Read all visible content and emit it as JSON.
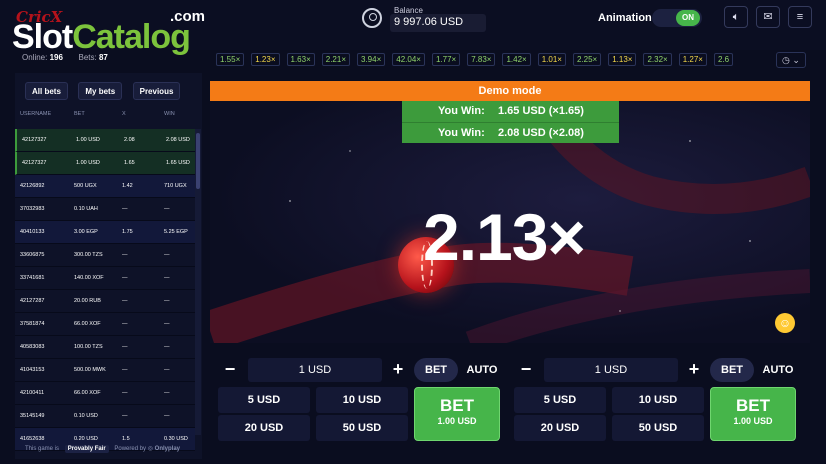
{
  "logo": {
    "crick": "CricX",
    "slot": "Slot",
    "catalog": "Catalog",
    "com": ".com"
  },
  "stats": {
    "online_label": "Online:",
    "online": "196",
    "bets_label": "Bets:",
    "bets": "87"
  },
  "balance": {
    "label": "Balance",
    "value": "9 997.06 USD"
  },
  "animation": {
    "label": "Animation",
    "state": "ON"
  },
  "history": [
    {
      "v": "1.55×",
      "c": "#8fd36b"
    },
    {
      "v": "1.23×",
      "c": "#f4d84a"
    },
    {
      "v": "1.63×",
      "c": "#8fd36b"
    },
    {
      "v": "2.21×",
      "c": "#8fd36b"
    },
    {
      "v": "3.94×",
      "c": "#8fd36b"
    },
    {
      "v": "42.04×",
      "c": "#8fd36b"
    },
    {
      "v": "1.77×",
      "c": "#8fd36b"
    },
    {
      "v": "7.83×",
      "c": "#8fd36b"
    },
    {
      "v": "1.42×",
      "c": "#8fd36b"
    },
    {
      "v": "1.01×",
      "c": "#f4d84a"
    },
    {
      "v": "2.25×",
      "c": "#8fd36b"
    },
    {
      "v": "1.13×",
      "c": "#f4d84a"
    },
    {
      "v": "2.32×",
      "c": "#8fd36b"
    },
    {
      "v": "1.27×",
      "c": "#f4d84a"
    },
    {
      "v": "2.6",
      "c": "#8fd36b"
    }
  ],
  "tabs": [
    "All bets",
    "My bets",
    "Previous"
  ],
  "columns": {
    "user": "USERNAME",
    "bet": "BET",
    "x": "X",
    "win": "WIN"
  },
  "bets": [
    {
      "user": "42127327",
      "bet": "1.00 USD",
      "x": "2.08",
      "win": "2.08 USD",
      "state": "win"
    },
    {
      "user": "42127327",
      "bet": "1.00 USD",
      "x": "1.65",
      "win": "1.65 USD",
      "state": "win"
    },
    {
      "user": "42126892",
      "bet": "500 UGX",
      "x": "1.42",
      "win": "710 UGX",
      "state": "lose"
    },
    {
      "user": "37032983",
      "bet": "0.10 UAH",
      "x": "—",
      "win": "—",
      "state": "alt"
    },
    {
      "user": "40410133",
      "bet": "3.00 EGP",
      "x": "1.75",
      "win": "5.25 EGP",
      "state": "lose"
    },
    {
      "user": "33606875",
      "bet": "300.00 TZS",
      "x": "—",
      "win": "—",
      "state": "alt"
    },
    {
      "user": "33741681",
      "bet": "140.00 XOF",
      "x": "—",
      "win": "—",
      "state": "alt"
    },
    {
      "user": "42127287",
      "bet": "20.00 RUB",
      "x": "—",
      "win": "—",
      "state": "alt"
    },
    {
      "user": "37581874",
      "bet": "66.00 XOF",
      "x": "—",
      "win": "—",
      "state": "alt"
    },
    {
      "user": "40583083",
      "bet": "100.00 TZS",
      "x": "—",
      "win": "—",
      "state": "alt"
    },
    {
      "user": "41043153",
      "bet": "500.00 MWK",
      "x": "—",
      "win": "—",
      "state": "alt"
    },
    {
      "user": "42100411",
      "bet": "66.00 XOF",
      "x": "—",
      "win": "—",
      "state": "alt"
    },
    {
      "user": "35145149",
      "bet": "0.10 USD",
      "x": "—",
      "win": "—",
      "state": "alt"
    },
    {
      "user": "41652638",
      "bet": "0.20 USD",
      "x": "1.5",
      "win": "0.30 USD",
      "state": "lose"
    }
  ],
  "footer": {
    "prefix": "This game is",
    "provably_fair": "Provably Fair",
    "powered": "Powered by",
    "brand": "Onlyplay"
  },
  "game": {
    "demo": "Demo mode",
    "wins": [
      {
        "label": "You Win:",
        "amount": "1.65 USD (×1.65)"
      },
      {
        "label": "You Win:",
        "amount": "2.08 USD (×2.08)"
      }
    ],
    "multiplier": "2.13×"
  },
  "panels": [
    {
      "value": "1 USD",
      "bet_tab": "BET",
      "auto_tab": "AUTO",
      "quick": [
        "5 USD",
        "10 USD",
        "20 USD",
        "50 USD"
      ],
      "bet_label": "BET",
      "bet_amount": "1.00 USD"
    },
    {
      "value": "1 USD",
      "bet_tab": "BET",
      "auto_tab": "AUTO",
      "quick": [
        "5 USD",
        "10 USD",
        "20 USD",
        "50 USD"
      ],
      "bet_label": "BET",
      "bet_amount": "1.00 USD"
    }
  ],
  "colors": {
    "accent_green": "#46b54a",
    "demo_orange": "#f47b16",
    "bg": "#0a0d1f"
  }
}
